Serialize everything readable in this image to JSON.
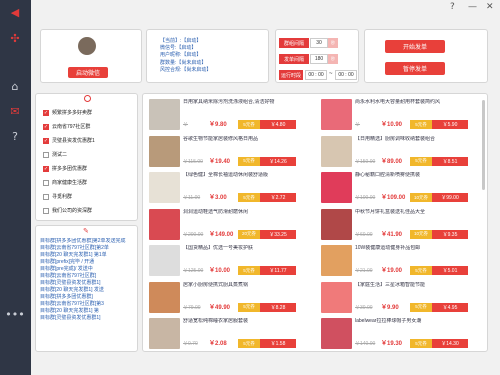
{
  "colors": {
    "accent": "#e8403a",
    "sidebar": "#2f3645",
    "coupon": "#f1b72b"
  },
  "sidebar": {
    "icons": [
      "network-icon",
      "home-icon",
      "mail-icon",
      "help-icon",
      "more-icon"
    ]
  },
  "window": {
    "help_glyph": "?",
    "minimize_glyph": "—",
    "close_glyph": "✕"
  },
  "profile": {
    "start_button": "启动微信"
  },
  "info": {
    "lines": [
      "【当前】:【启动】",
      "微信号:【启动】",
      "用户昵称:【启动】",
      "群数量:【尚未启动】",
      "风控合规:【尚未启动】"
    ]
  },
  "settings": {
    "interval_label": "群组间隔",
    "interval_value": "30",
    "interval_unit": "秒",
    "send_label": "发单间隔",
    "send_value": "180",
    "send_unit": "秒",
    "time_label": "运行时段",
    "time_start": "00 : 00",
    "tilde": "~",
    "time_end": "00 : 00"
  },
  "actions": {
    "start": "开始发单",
    "pause": "暂停发单"
  },
  "groups": {
    "items": [
      {
        "label": "频繁拼多多好卖群",
        "checked": true
      },
      {
        "label": "云南省797社区群",
        "checked": true
      },
      {
        "label": "灵璧县资发优惠群1",
        "checked": true
      },
      {
        "label": "测试二",
        "checked": false
      },
      {
        "label": "拼多多团优惠群",
        "checked": true
      },
      {
        "label": "商家健康生活群",
        "checked": false
      },
      {
        "label": "寻觅利群",
        "checked": false
      },
      {
        "label": "我们公司的资深群",
        "checked": false
      }
    ]
  },
  "log": {
    "lines": [
      "目标群[拼多多团优惠群]第2单发送完成",
      "目标群[云南省797社区群]第2单",
      "目标群[20 聊天完发群1] 第1单",
      "目标群[prefix]完毕 / 开通",
      "目标群[pre完成]/ 发送中",
      "目标群[云南省797社区群]",
      "目标群[灵璧县资发优惠群1]",
      "目标群[20 聊天完发群1] 发送",
      "目标群[拼多多团优惠群]",
      "目标群[云南省797社区群]第3",
      "目标群[20 聊天完发群1] 第",
      "目标群[灵璧县资发优惠群1]"
    ]
  },
  "products": [
    {
      "title": "日用家具纳米除污剂洗涤液组合,清洁好物",
      "orig": "￥",
      "price": "￥9.80",
      "badge": "5元券",
      "after": "￥4.80",
      "color": "#c9c2b8"
    },
    {
      "title": "尚永水利水电大容量耐用杯套装简约风",
      "orig": "￥",
      "price": "￥10.90",
      "badge": "5元券",
      "after": "￥5.90",
      "color": "#e96a78"
    },
    {
      "title": "谷歌生物节能家居装修风格日用品",
      "orig": "￥115.00",
      "price": "￥19.40",
      "badge": "5元券",
      "after": "￥14.26",
      "color": "#b89a7a"
    },
    {
      "title": "【日用精选】厨房调味收纳套装组合",
      "orig": "￥150.00",
      "price": "￥89.00",
      "badge": "5元券",
      "after": "￥8.51",
      "color": "#d7c6b1"
    },
    {
      "title": "【绿色健】全棉长袖运动休闲装舒适版",
      "orig": "￥11.00",
      "price": "￥3.00",
      "badge": "5元券",
      "after": "￥2.72",
      "color": "#e7e1d6"
    },
    {
      "title": "静心秘籍口腔清新喷雾便携装",
      "orig": "￥100.00",
      "price": "￥109.00",
      "badge": "10元券",
      "after": "￥99.00",
      "color": "#e03c5a"
    },
    {
      "title": "洞洞运动鞋透气防滑耐磨休闲",
      "orig": "￥200.00",
      "price": "￥149.00",
      "badge": "20元券",
      "after": "￥33.25",
      "color": "#d94a52"
    },
    {
      "title": "中秋节月饼礼盒装送礼佳品大全",
      "orig": "￥60.00",
      "price": "￥41.90",
      "badge": "10元券",
      "after": "￥9.35",
      "color": "#b04848"
    },
    {
      "title": "【国货精品】优选一号美妆护肤",
      "orig": "￥125.00",
      "price": "￥10.00",
      "badge": "5元券",
      "after": "￥11.77",
      "color": "#ddd"
    },
    {
      "title": "10W装健康运动健身补品包邮",
      "orig": "￥21.00",
      "price": "￥19.00",
      "badge": "5元券",
      "after": "￥5.01",
      "color": "#e2a060"
    },
    {
      "title": "居家小厨房便携式厨具蒸煮锅",
      "orig": "￥79.00",
      "price": "￥49.90",
      "badge": "5元券",
      "after": "￥8.28",
      "color": "#cf8a5a"
    },
    {
      "title": "【家庭生活】三星冰箱智能节能",
      "orig": "￥30.00",
      "price": "￥9.90",
      "badge": "5元券",
      "after": "￥4.95",
      "color": "#f07a7a"
    },
    {
      "title": "舒适宽松纯棉睡衣家居服套装",
      "orig": "￥0.70",
      "price": "￥2.08",
      "badge": "5元券",
      "after": "￥1.58",
      "color": "#c8b6a4"
    },
    {
      "title": "labelwear拉拉棒球帽子男女潮",
      "orig": "￥140.00",
      "price": "￥19.30",
      "badge": "5元券",
      "after": "￥14.30",
      "color": "#d05060"
    }
  ]
}
